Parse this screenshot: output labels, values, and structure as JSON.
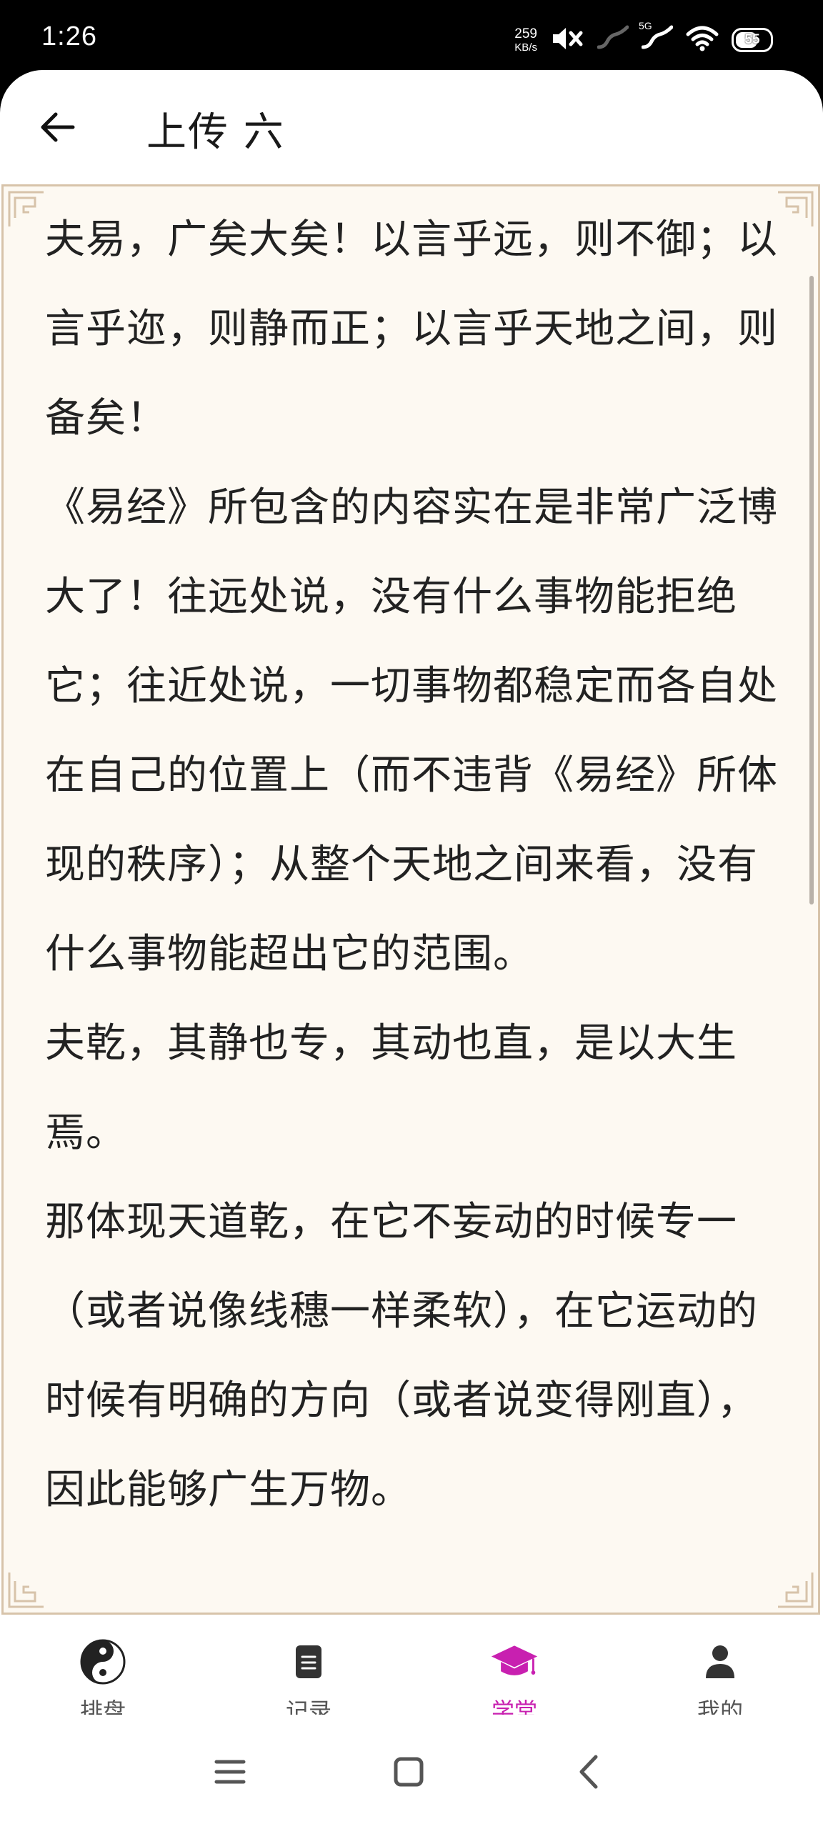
{
  "status_bar": {
    "time": "1:26",
    "net_speed_value": "259",
    "net_speed_unit": "KB/s",
    "network_label": "5G",
    "battery_level": "55"
  },
  "header": {
    "title": "上传 六"
  },
  "reader": {
    "paragraphs": [
      "夫易，广矣大矣！以言乎远，则不御；以言乎迩，则静而正；以言乎天地之间，则备矣！",
      "《易经》所包含的内容实在是非常广泛博大了！往远处说，没有什么事物能拒绝它；往近处说，一切事物都稳定而各自处在自己的位置上（而不违背《易经》所体现的秩序）；从整个天地之间来看，没有什么事物能超出它的范围。",
      "夫乾，其静也专，其动也直，是以大生焉。",
      "那体现天道乾，在它不妄动的时候专一（或者说像线穗一样柔软），在它运动的时候有明确的方向（或者说变得刚直），因此能够广生万物。"
    ]
  },
  "bottom_nav": {
    "items": [
      {
        "label": "排盘",
        "icon": "yin-yang-icon"
      },
      {
        "label": "记录",
        "icon": "record-icon"
      },
      {
        "label": "学堂",
        "icon": "graduation-cap-icon"
      },
      {
        "label": "我的",
        "icon": "person-icon"
      }
    ],
    "active_index": 2,
    "active_color": "#c820b0"
  },
  "theme": {
    "reader_background": "#fdf9f2",
    "reader_border": "#d7c3aa"
  }
}
